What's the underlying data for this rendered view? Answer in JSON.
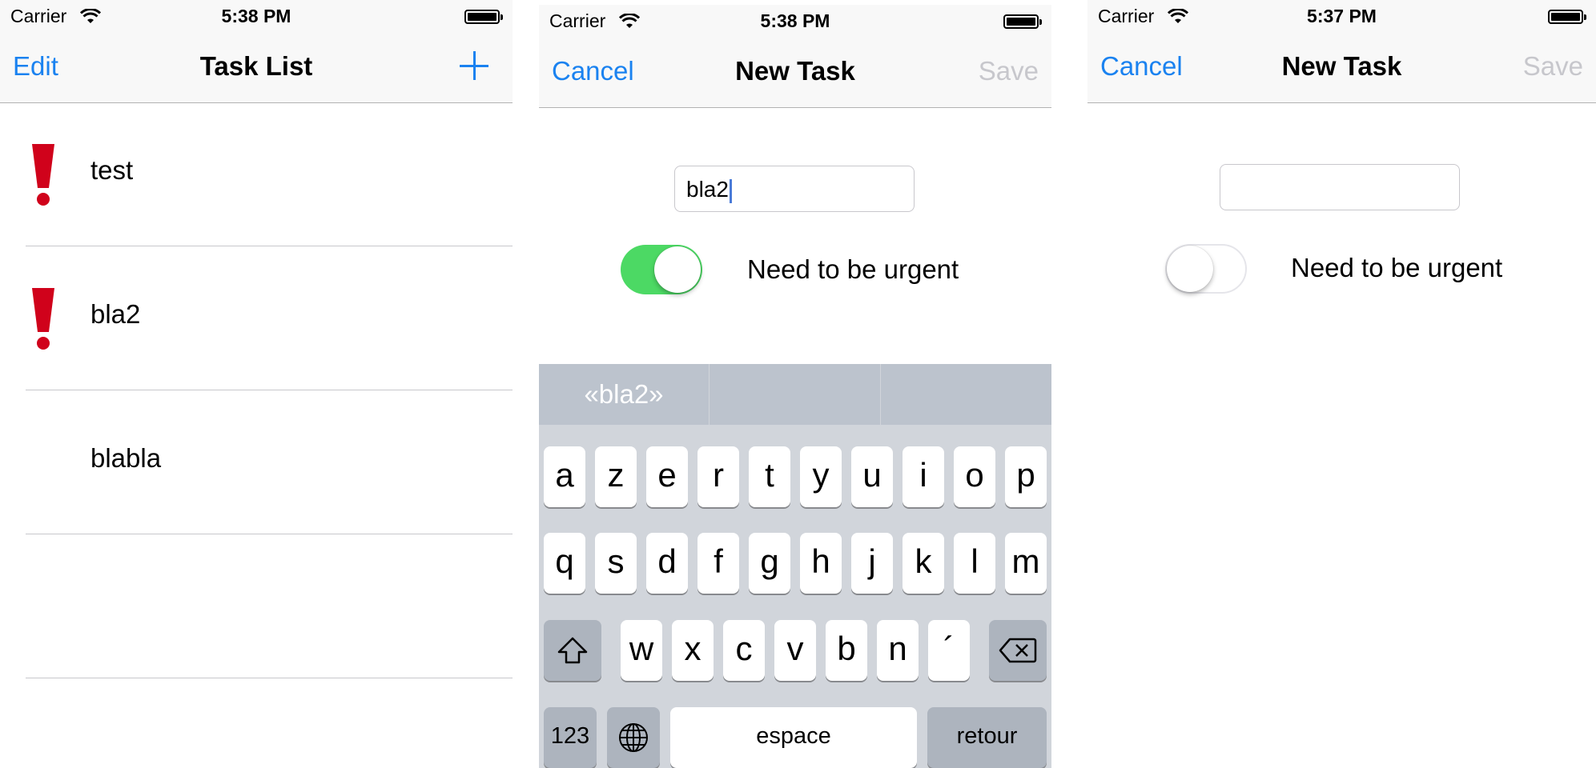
{
  "status_bar": {
    "carrier": "Carrier",
    "time_list": "5:38 PM",
    "time_new": "5:38 PM",
    "time_empty": "5:37 PM"
  },
  "task_list_screen": {
    "edit_label": "Edit",
    "title": "Task List",
    "add_icon": "plus-icon",
    "tasks": [
      {
        "name": "test",
        "urgent": true
      },
      {
        "name": "bla2",
        "urgent": true
      },
      {
        "name": "blabla",
        "urgent": false
      }
    ]
  },
  "new_task_filled": {
    "cancel_label": "Cancel",
    "title": "New Task",
    "save_label": "Save",
    "task_text": "bla2",
    "urgent_on": true,
    "urgent_label": "Need to be urgent",
    "suggestion": "«bla2»",
    "keyboard": {
      "row1": [
        "a",
        "z",
        "e",
        "r",
        "t",
        "y",
        "u",
        "i",
        "o",
        "p"
      ],
      "row2": [
        "q",
        "s",
        "d",
        "f",
        "g",
        "h",
        "j",
        "k",
        "l",
        "m"
      ],
      "row3": [
        "w",
        "x",
        "c",
        "v",
        "b",
        "n",
        "´"
      ],
      "numbers": "123",
      "space": "espace",
      "return": "retour"
    }
  },
  "new_task_empty": {
    "cancel_label": "Cancel",
    "title": "New Task",
    "save_label": "Save",
    "task_text": "",
    "urgent_on": false,
    "urgent_label": "Need to be urgent"
  },
  "colors": {
    "tint": "#1a82f0",
    "urgent_red": "#d0021b",
    "switch_on": "#4cd964",
    "disabled": "#c7c7cc"
  }
}
